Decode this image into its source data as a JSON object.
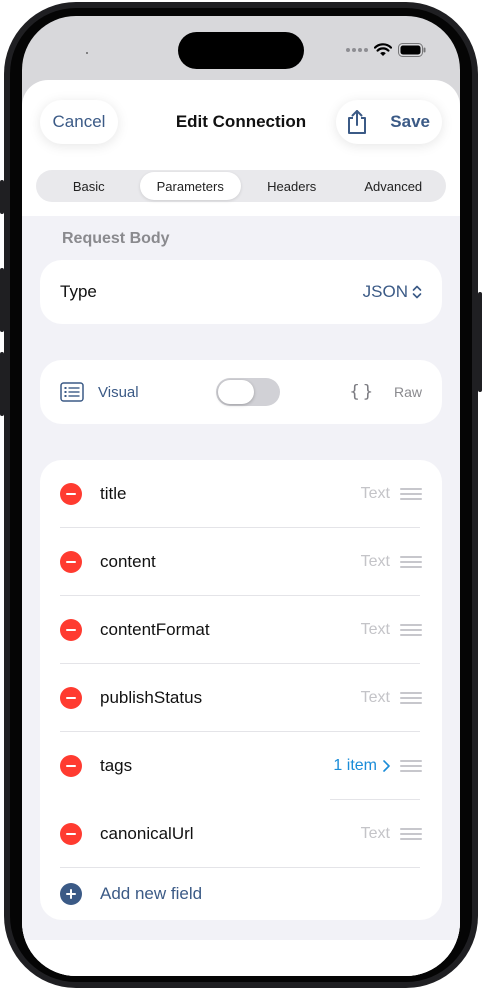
{
  "nav": {
    "cancel_label": "Cancel",
    "title": "Edit Connection",
    "save_label": "Save",
    "share_icon": "share-icon"
  },
  "tabs": [
    {
      "label": "Basic",
      "active": false
    },
    {
      "label": "Parameters",
      "active": true
    },
    {
      "label": "Headers",
      "active": false
    },
    {
      "label": "Advanced",
      "active": false
    }
  ],
  "request_body": {
    "section_title": "Request Body",
    "type_label": "Type",
    "type_value": "JSON",
    "visual_label": "Visual",
    "raw_label": "Raw",
    "raw_icon": "{}",
    "mode_toggle_on": false
  },
  "fields": [
    {
      "name": "title",
      "type": "Text"
    },
    {
      "name": "content",
      "type": "Text"
    },
    {
      "name": "contentFormat",
      "type": "Text"
    },
    {
      "name": "publishStatus",
      "type": "Text"
    },
    {
      "name": "tags",
      "type": "1 item"
    },
    {
      "name": "canonicalUrl",
      "type": "Text"
    }
  ],
  "add_field_label": "Add new field",
  "colors": {
    "accent": "#3b5a86",
    "delete": "#ff3b30",
    "link": "#1a8cd8",
    "background": "#f2f2f7"
  }
}
